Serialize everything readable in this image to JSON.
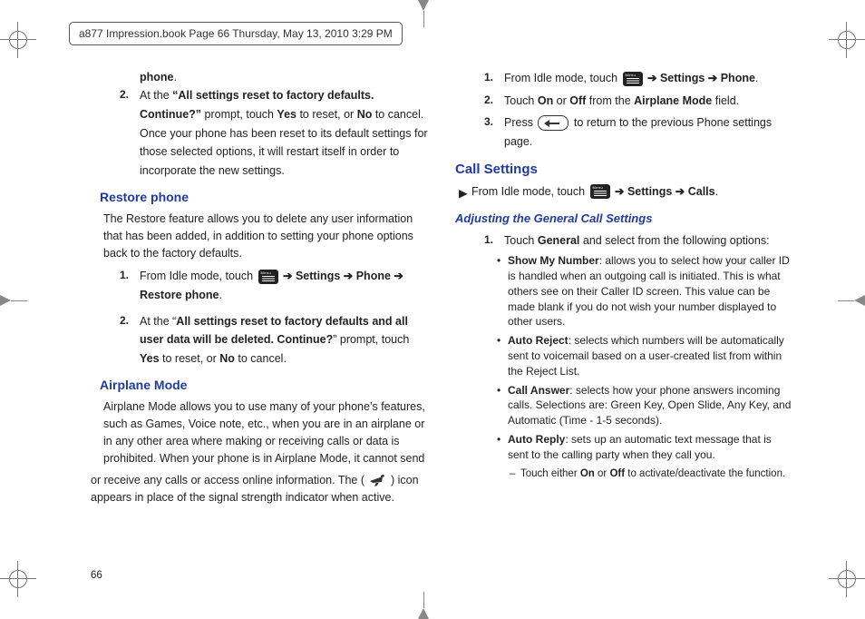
{
  "header": {
    "breadcrumb": "a877 Impression.book  Page 66  Thursday, May 13, 2010  3:29 PM"
  },
  "page_number": "66",
  "arrow": "➔",
  "tri": "▶",
  "col1": {
    "tail_bold": "phone",
    "tail_period": ".",
    "step2_num": "2.",
    "step2_a": "At the ",
    "step2_b": "“All settings reset to factory defaults. Continue?”",
    "step2_c": " prompt, touch ",
    "step2_d": "Yes",
    "step2_e": " to reset, or ",
    "step2_f": "No",
    "step2_g": " to cancel. Once your phone has been reset to its default settings for those selected options, it will restart itself in order to incorporate the new settings.",
    "h_restore": "Restore phone",
    "restore_para": "The Restore feature allows you to delete any user information that has been added, in addition to setting your phone options back to the factory defaults.",
    "r1_num": "1.",
    "r1_a": "From Idle mode, touch ",
    "r1_b": " Settings ",
    "r1_c": " Phone ",
    "r1_d": " Restore phone",
    "r1_e": ".",
    "r2_num": "2.",
    "r2_a": "At the “",
    "r2_b": "All settings reset to factory defaults and all user data will be deleted. Continue?",
    "r2_c": "” prompt, touch ",
    "r2_d": "Yes",
    "r2_e": " to reset, or ",
    "r2_f": "No",
    "r2_g": " to cancel.",
    "h_air": "Airplane Mode",
    "air_para": "Airplane Mode allows you to use many of your phone’s features, such as Games, Voice note, etc., when you are in an airplane or in any other area where making or receiving calls or data is prohibited. When your phone is in Airplane Mode, it cannot send"
  },
  "col2": {
    "air_tail_a": "or receive any calls or access online information. The (",
    "air_tail_b": ") icon appears in place of the signal strength indicator when active.",
    "a1_num": "1.",
    "a1_a": "From Idle mode, touch ",
    "a1_b": " Settings ",
    "a1_c": " Phone",
    "a1_d": ".",
    "a2_num": "2.",
    "a2_a": "Touch ",
    "a2_b": "On",
    "a2_c": " or ",
    "a2_d": "Off",
    "a2_e": " from the ",
    "a2_f": "Airplane Mode",
    "a2_g": " field.",
    "a3_num": "3.",
    "a3_a": "Press ",
    "a3_b": " to return to the previous Phone settings page.",
    "h_call": "Call Settings",
    "cs_a": "From Idle mode, touch ",
    "cs_b": " Settings ",
    "cs_c": " Calls",
    "cs_d": ".",
    "h_adj": "Adjusting the General Call Settings",
    "g1_num": "1.",
    "g1_a": "Touch ",
    "g1_b": "General",
    "g1_c": " and select from the following options:",
    "b1_t": "Show My Number",
    "b1_r": ": allows you to select how your caller ID is handled when an outgoing call is initiated. This is what others see on their Caller ID screen. This value can be made blank if you do not wish your number displayed to other users.",
    "b2_t": "Auto Reject",
    "b2_r": ": selects which numbers will be automatically sent to voicemail based on a user-created list from within the Reject List.",
    "b3_t": "Call Answer",
    "b3_r": ": selects how your phone answers incoming calls. Selections are: Green Key, Open Slide, Any Key, and Automatic (Time - 1-5 seconds).",
    "b4_t": "Auto Reply",
    "b4_r": ": sets up an automatic text message that is sent to the calling party when they call you.",
    "s1_a": "Touch either ",
    "s1_b": "On",
    "s1_c": " or ",
    "s1_d": "Off",
    "s1_e": " to activate/deactivate the function."
  }
}
